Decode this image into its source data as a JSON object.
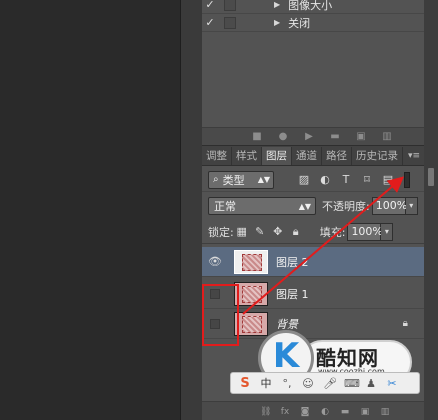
{
  "actions": {
    "rows": [
      {
        "checked": "✓",
        "label": "图像大小"
      },
      {
        "checked": "✓",
        "label": "关闭"
      }
    ]
  },
  "layers_panel": {
    "tabs": [
      "调整",
      "样式",
      "图层",
      "通道",
      "路径",
      "历史记录"
    ],
    "active_tab": "图层",
    "filter": {
      "label": "类型"
    },
    "blend_mode": "正常",
    "opacity_label": "不透明度:",
    "opacity_value": "100%",
    "lock_label": "锁定:",
    "fill_label": "填充:",
    "fill_value": "100%",
    "layers": [
      {
        "name": "图层 2",
        "visible": true,
        "selected": true
      },
      {
        "name": "图层 1",
        "visible": false,
        "selected": false
      },
      {
        "name": "背景",
        "visible": false,
        "selected": false,
        "locked": true
      }
    ]
  },
  "watermark": {
    "title": "酷知网",
    "url": "www.coozhi.com"
  },
  "colors": {
    "panel_bg": "#535353",
    "selected_layer": "#5b6b81",
    "highlight_red": "#e21c1c"
  }
}
